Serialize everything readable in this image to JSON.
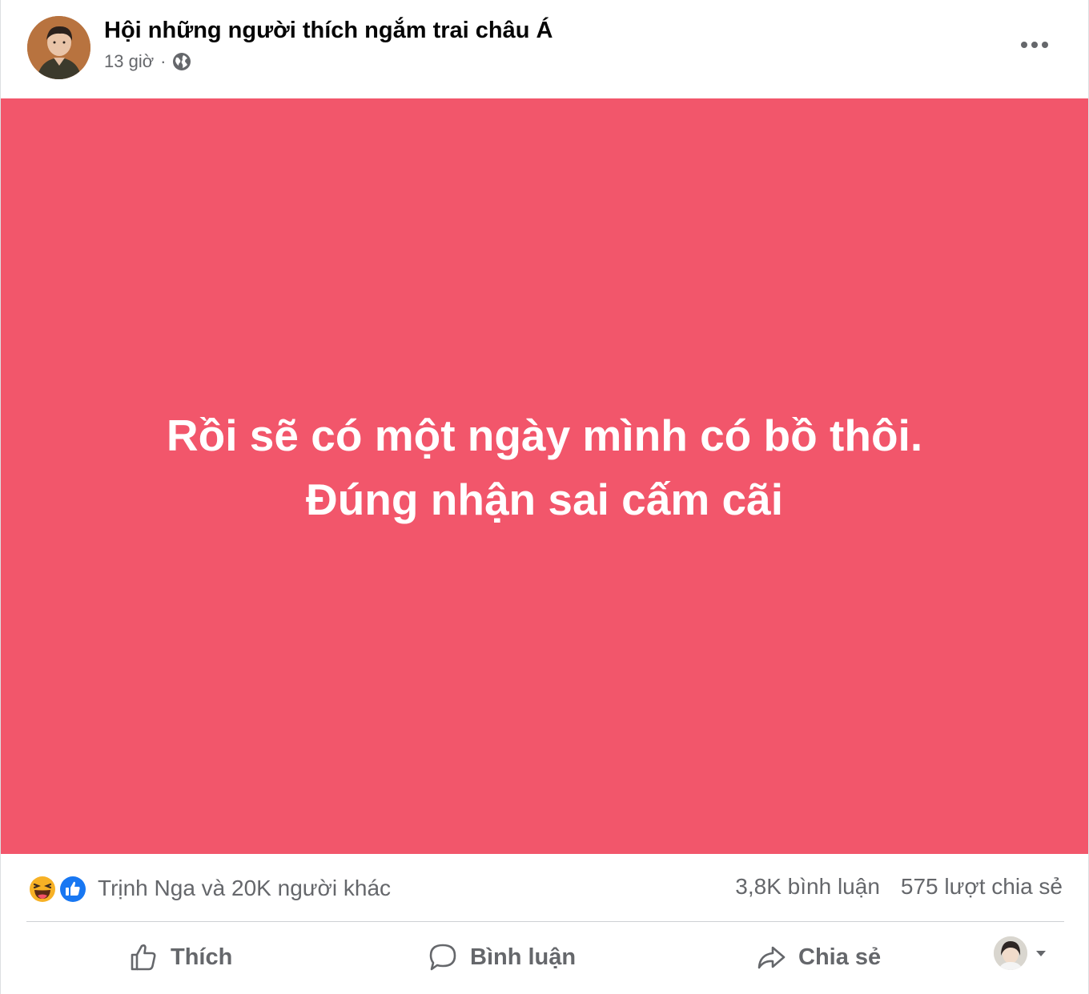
{
  "post": {
    "author": "Hội những người thích ngắm trai châu Á",
    "time": "13 giờ",
    "separator": "·",
    "icons": {
      "avatar": "group-avatar",
      "privacy": "globe-icon",
      "menu": "more-horizontal-icon"
    },
    "content": {
      "line1": "Rồi sẽ có một ngày mình có bồ thôi.",
      "line2": "Đúng nhận sai cấm cãi",
      "background_color": "#f2566b",
      "text_color": "#ffffff"
    }
  },
  "engagement": {
    "reaction_icons": [
      "haha-reaction-icon",
      "like-reaction-icon"
    ],
    "reactions_text": "Trịnh Nga và 20K người khác",
    "comments": "3,8K bình luận",
    "shares": "575 lượt chia sẻ"
  },
  "actions": {
    "like_label": "Thích",
    "comment_label": "Bình luận",
    "share_label": "Chia sẻ"
  },
  "colors": {
    "secondary_text": "#65676b",
    "primary_text": "#050505",
    "like_blue": "#1877f2"
  }
}
